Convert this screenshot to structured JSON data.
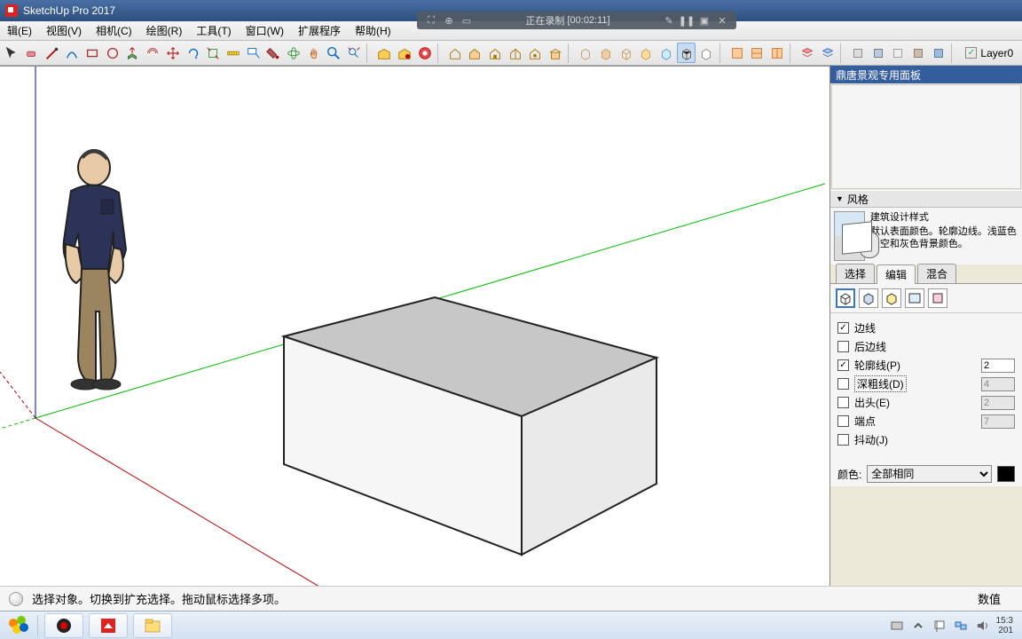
{
  "window": {
    "title": "SketchUp Pro 2017"
  },
  "menus": [
    "辑(E)",
    "视图(V)",
    "相机(C)",
    "绘图(R)",
    "工具(T)",
    "窗口(W)",
    "扩展程序",
    "帮助(H)"
  ],
  "recorder": {
    "status": "正在录制",
    "time": "[00:02:11]"
  },
  "layers": {
    "current": "Layer0"
  },
  "panel": {
    "header": "鼎唐景观专用面板",
    "section": "风格",
    "style_name": "建筑设计样式",
    "style_desc": "默认表面颜色。轮廓边线。浅蓝色天空和灰色背景颜色。"
  },
  "subtabs": [
    "选择",
    "编辑",
    "混合"
  ],
  "edge_options": {
    "edges": {
      "label": "边线",
      "checked": true
    },
    "back": {
      "label": "后边线",
      "checked": false
    },
    "profile": {
      "label": "轮廓线(P)",
      "checked": true,
      "value": "2"
    },
    "depth": {
      "label": "深粗线(D)",
      "checked": false,
      "value": "4"
    },
    "ext": {
      "label": "出头(E)",
      "checked": false,
      "value": "2"
    },
    "end": {
      "label": "端点",
      "checked": false,
      "value": "7"
    },
    "jitter": {
      "label": "抖动(J)",
      "checked": false
    }
  },
  "color": {
    "label": "颜色:",
    "mode": "全部相同"
  },
  "status": {
    "help": "选择对象。切换到扩充选择。拖动鼠标选择多项。",
    "value_label": "数值"
  },
  "clock": {
    "time": "15:3",
    "date": "201"
  }
}
